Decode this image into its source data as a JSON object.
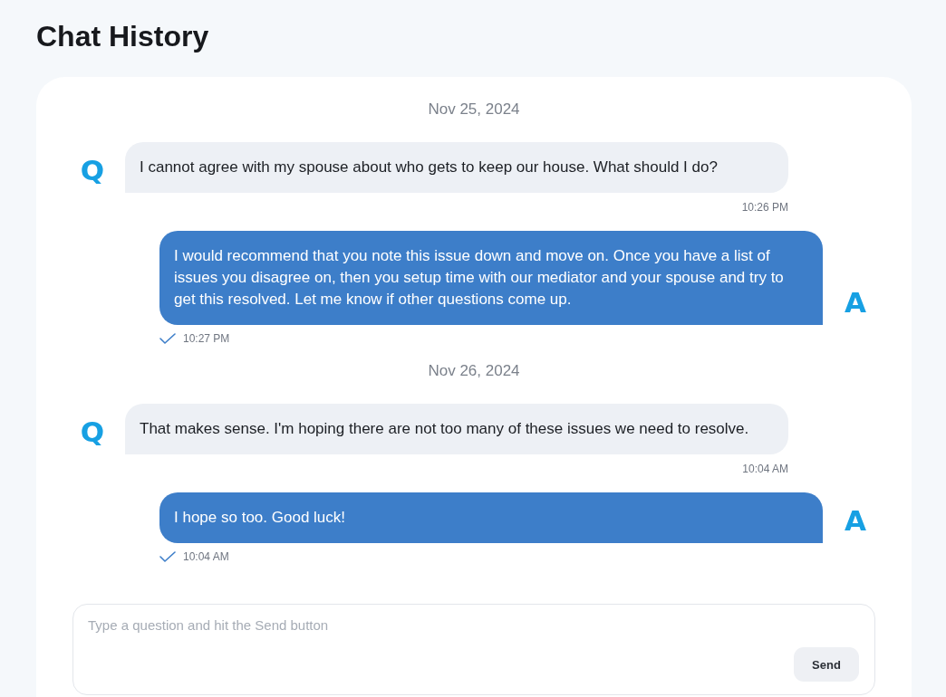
{
  "page": {
    "title": "Chat History"
  },
  "conversation": [
    {
      "date": "Nov 25, 2024",
      "messages": [
        {
          "kind": "question",
          "avatar": "Q",
          "text": "I cannot agree with my spouse about who gets to keep our house. What should I do?",
          "time": "10:26 PM"
        },
        {
          "kind": "answer",
          "avatar": "A",
          "text": "I would recommend that you note this issue down and move on. Once you have a list of issues you disagree on, then you setup time with our mediator and your spouse and try to get this resolved. Let me know if other questions come up.",
          "time": "10:27 PM",
          "delivered": true
        }
      ]
    },
    {
      "date": "Nov 26, 2024",
      "messages": [
        {
          "kind": "question",
          "avatar": "Q",
          "text": "That makes sense. I'm hoping there are not too many of these issues we need to resolve.",
          "time": "10:04 AM"
        },
        {
          "kind": "answer",
          "avatar": "A",
          "text": "I hope so too. Good luck!",
          "time": "10:04 AM",
          "delivered": true
        }
      ]
    }
  ],
  "composer": {
    "placeholder": "Type a question and hit the Send button",
    "button": "Send"
  }
}
